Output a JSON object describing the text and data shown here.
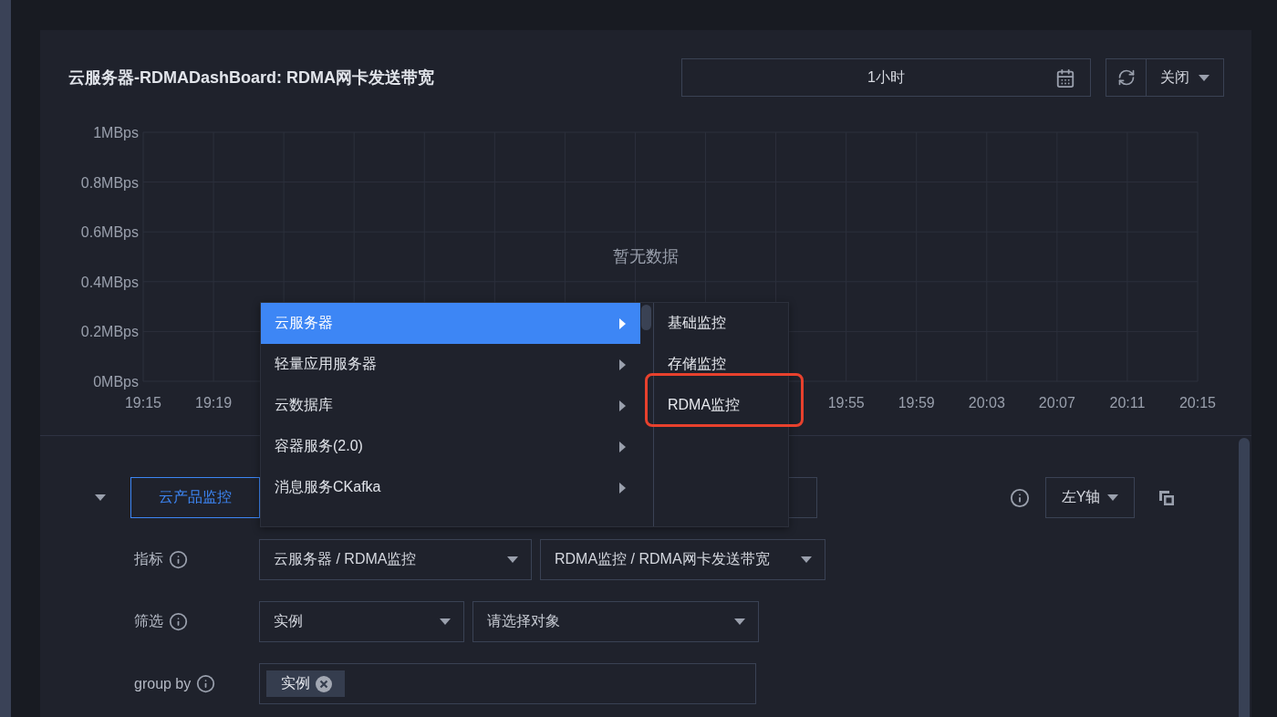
{
  "header": {
    "title": "云服务器-RDMADashBoard: RDMA网卡发送带宽",
    "time_range": "1小时",
    "auto_refresh": "关闭"
  },
  "chart": {
    "empty_text": "暂无数据",
    "chart_data": {
      "type": "line",
      "grid": true,
      "ylim": [
        0,
        1
      ],
      "yticks": [
        {
          "value": 0,
          "label": "0MBps"
        },
        {
          "value": 0.2,
          "label": "0.2MBps"
        },
        {
          "value": 0.4,
          "label": "0.4MBps"
        },
        {
          "value": 0.6,
          "label": "0.6MBps"
        },
        {
          "value": 0.8,
          "label": "0.8MBps"
        },
        {
          "value": 1,
          "label": "1MBps"
        }
      ],
      "categories": [
        "19:15",
        "19:19",
        null,
        null,
        null,
        null,
        null,
        null,
        null,
        null,
        "19:55",
        "19:59",
        "20:03",
        "20:07",
        "20:11",
        "20:15"
      ]
    }
  },
  "menu": {
    "items": [
      {
        "label": "云服务器",
        "selected": true
      },
      {
        "label": "轻量应用服务器",
        "selected": false
      },
      {
        "label": "云数据库",
        "selected": false
      },
      {
        "label": "容器服务(2.0)",
        "selected": false
      },
      {
        "label": "消息服务CKafka",
        "selected": false
      }
    ],
    "submenu": [
      {
        "label": "基础监控",
        "highlighted": false
      },
      {
        "label": "存储监控",
        "highlighted": false
      },
      {
        "label": "RDMA监控",
        "highlighted": true
      }
    ]
  },
  "query": {
    "expanded": true,
    "source_tab": {
      "label": "云产品监控",
      "selected": true
    },
    "axis": "左Y轴",
    "rows": [
      {
        "label": "指标",
        "kind": "selects",
        "selects": [
          {
            "value": "云服务器 / RDMA监控"
          },
          {
            "value": "RDMA监控 / RDMA网卡发送带宽"
          }
        ]
      },
      {
        "label": "筛选",
        "kind": "selects",
        "selects": [
          {
            "value": "实例"
          },
          {
            "placeholder": "请选择对象"
          }
        ]
      },
      {
        "label": "group by",
        "kind": "tags",
        "tags": [
          "实例"
        ]
      }
    ]
  }
}
